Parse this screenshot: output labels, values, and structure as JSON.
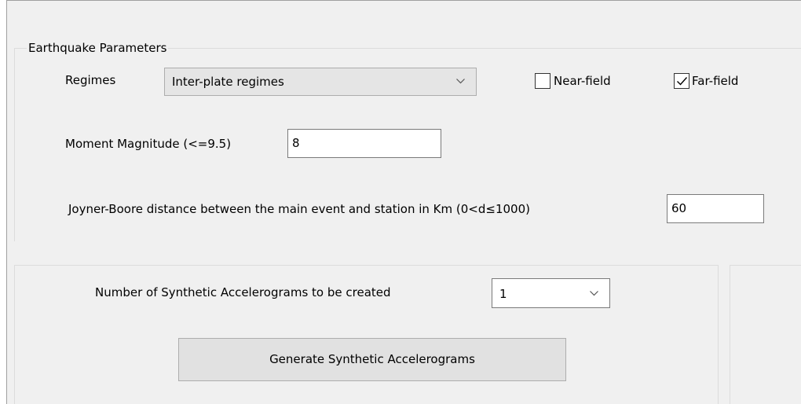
{
  "earthquake_group": {
    "title": "Earthquake Parameters",
    "regimes_label": "Regimes",
    "regimes_value": "Inter-plate regimes",
    "near_field_label": "Near-field",
    "near_field_checked": false,
    "far_field_label": "Far-field",
    "far_field_checked": true,
    "magnitude_label": "Moment Magnitude (<=9.5)",
    "magnitude_value": "8",
    "distance_label": "Joyner-Boore distance between the main event and station in Km (0<d≤1000)",
    "distance_value": "60"
  },
  "generation": {
    "count_label": "Number of Synthetic Accelerograms to be created",
    "count_value": "1",
    "generate_button_label": "Generate Synthetic Accelerograms"
  }
}
